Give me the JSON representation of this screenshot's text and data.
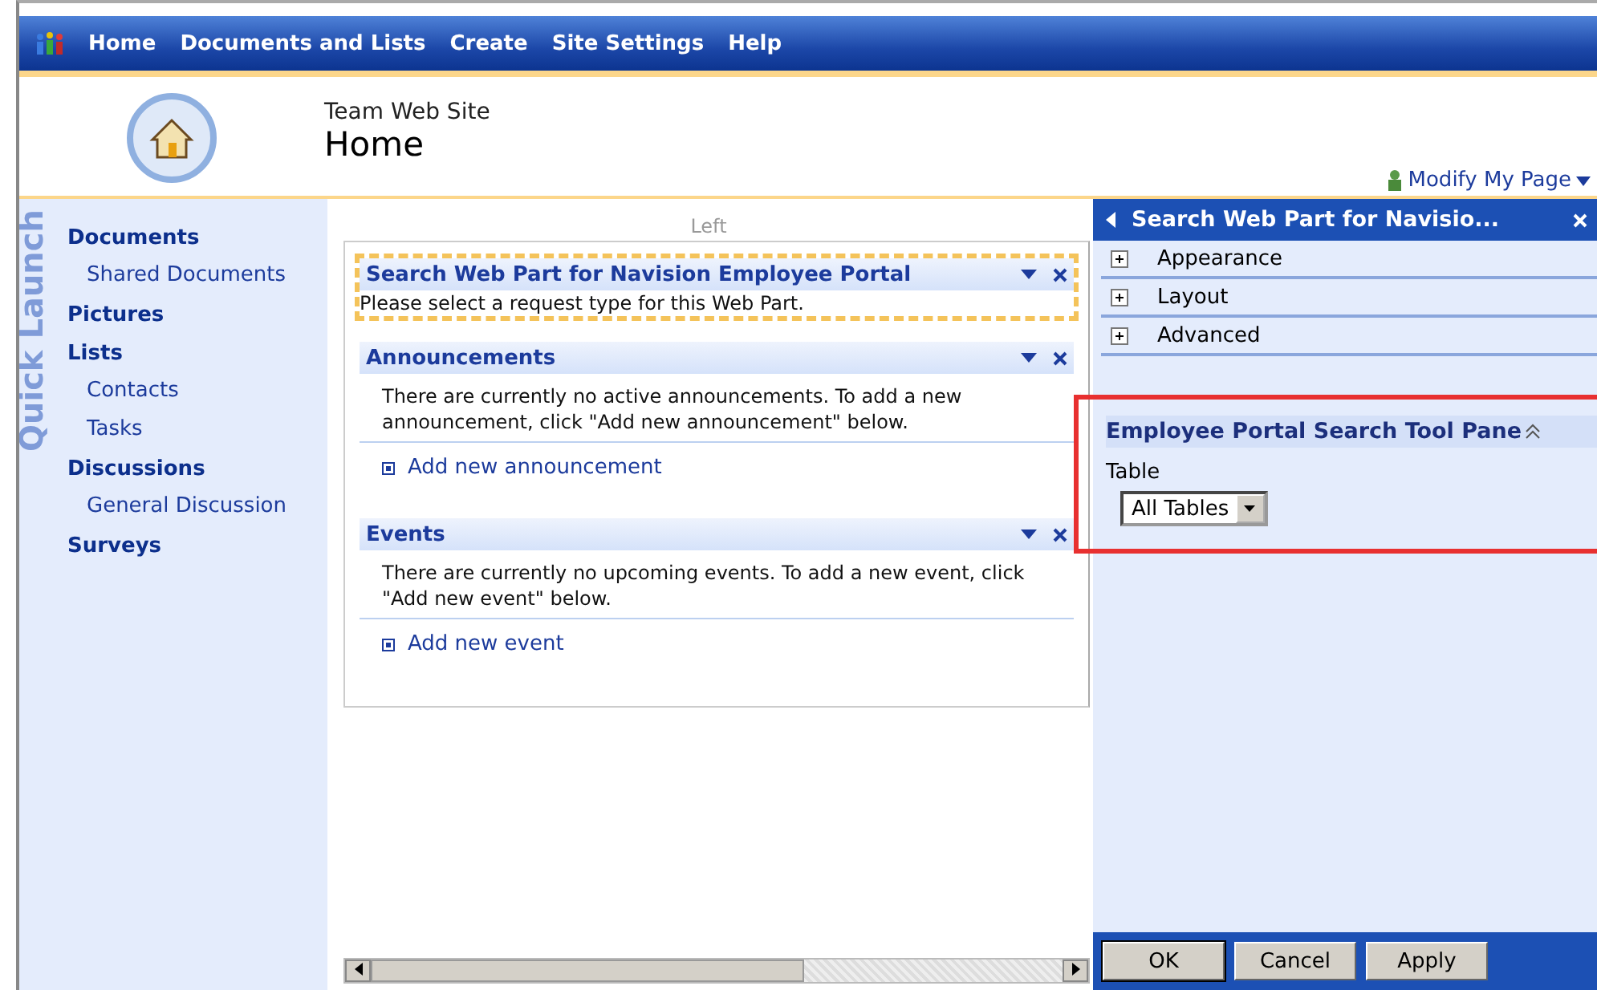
{
  "top_nav": {
    "items": [
      {
        "label": "Home"
      },
      {
        "label": "Documents and Lists"
      },
      {
        "label": "Create"
      },
      {
        "label": "Site Settings"
      },
      {
        "label": "Help"
      }
    ]
  },
  "header": {
    "site_name": "Team Web Site",
    "page_title": "Home",
    "modify_link": "Modify My Page"
  },
  "quick_launch": {
    "watermark": "Quick Launch",
    "items": [
      {
        "label": "Documents",
        "kind": "heading"
      },
      {
        "label": "Shared Documents",
        "kind": "link"
      },
      {
        "label": "Pictures",
        "kind": "heading"
      },
      {
        "label": "Lists",
        "kind": "heading"
      },
      {
        "label": "Contacts",
        "kind": "link"
      },
      {
        "label": "Tasks",
        "kind": "link"
      },
      {
        "label": "Discussions",
        "kind": "heading"
      },
      {
        "label": "General Discussion",
        "kind": "link"
      },
      {
        "label": "Surveys",
        "kind": "heading"
      }
    ]
  },
  "zone": {
    "title": "Left",
    "web_parts": [
      {
        "title": "Search Web Part for Navision Employee Portal",
        "selected": true,
        "body": "Please select a request type for this Web Part."
      },
      {
        "title": "Announcements",
        "selected": false,
        "body": "There are currently no active announcements. To add a new announcement, click \"Add new announcement\" below.",
        "link": "Add new announcement"
      },
      {
        "title": "Events",
        "selected": false,
        "body": "There are currently no upcoming events. To add a new event, click \"Add new event\" below.",
        "link": "Add new event"
      }
    ]
  },
  "tool_pane": {
    "title": "Search Web Part for Navisio...",
    "sections": [
      {
        "label": "Appearance",
        "expanded": false
      },
      {
        "label": "Layout",
        "expanded": false
      },
      {
        "label": "Advanced",
        "expanded": false
      }
    ],
    "custom_pane": {
      "title": "Employee Portal Search Tool Pane",
      "field_label": "Table",
      "dropdown_value": "All Tables"
    },
    "buttons": [
      "OK",
      "Cancel",
      "Apply"
    ]
  }
}
